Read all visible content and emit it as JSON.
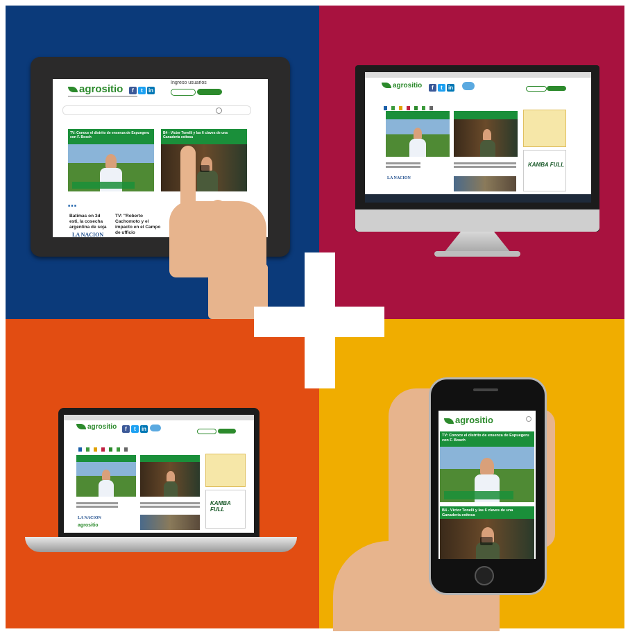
{
  "brand": {
    "logo": "agrositio"
  },
  "tablet": {
    "login_title": "Ingreso usuarios",
    "headline_1": "TV: Conoce el distrito de ensenza de Espuegeru con F. Bosch",
    "headline_2": "B4 - Víctor Tonelli y las 6 claves de una Ganadería exitosa",
    "story_1": "Batimas on 3d esti, la cosecha argentina de soja",
    "story_2": "TV: \"Roberto Cachomoto y el impacto en el Campo de ufficio",
    "partner": "LA NACION"
  },
  "monitor": {
    "partner": "LA NACION",
    "ad": "KAMBA FULL"
  },
  "laptop": {
    "partner": "LA NACION",
    "ad": "KAMBA FULL"
  },
  "phone": {
    "headline_1": "TV: Conoce el distrito de ensenza de Espuegeru con F. Bosch",
    "headline_2": "B4 - Víctor Tonelli y las 6 claves de una Ganadería exitosa"
  }
}
